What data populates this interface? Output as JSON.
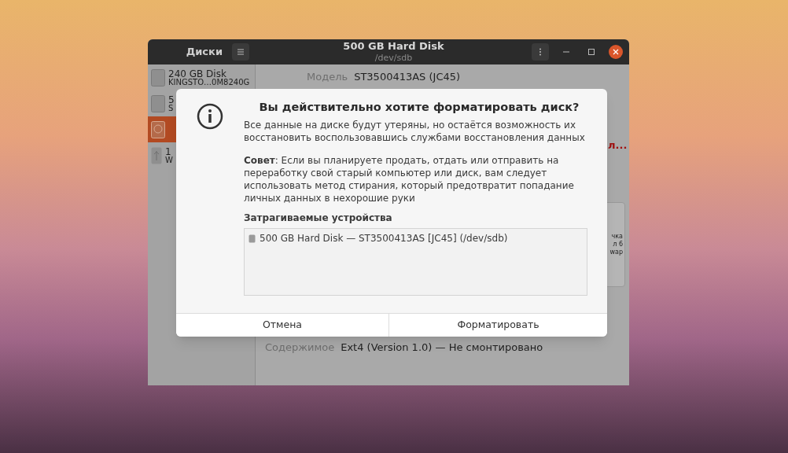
{
  "window": {
    "app_title": "Диски",
    "title": "500 GB Hard Disk",
    "subtitle": "/dev/sdb"
  },
  "sidebar": {
    "items": [
      {
        "kind": "ssd",
        "title": "240 GB Disk",
        "subtitle": "KINGSTO…0M8240G",
        "selected": false
      },
      {
        "kind": "ssd",
        "title": "5",
        "subtitle": "S",
        "selected": false
      },
      {
        "kind": "hdd",
        "selected": true
      },
      {
        "kind": "usb",
        "title": "1",
        "subtitle": "W",
        "selected": false
      }
    ]
  },
  "content": {
    "model_label": "Модель",
    "model_value": "ST3500413AS (JC45)",
    "warning": "л...",
    "partition_labels": [
      "чка",
      "л 6",
      "wap"
    ],
    "contents_label": "Содержимое",
    "contents_value": "Ext4 (Version 1.0) — Не смонтировано"
  },
  "dialog": {
    "title": "Вы действительно хотите форматировать диск?",
    "message": "Все данные на диске будут утеряны, но остаётся возможность их восстановить воспользовавшись службами восстановления данных",
    "advice": "**Совет**: Если вы планируете продать, отдать или отправить на переработку свой старый компьютер или диск, вам следует использовать метод стирания, который предотвратит попадание личных данных в нехорошие руки",
    "devices_heading": "Затрагиваемые устройства",
    "devices": [
      "500 GB Hard Disk — ST3500413AS [JC45] (/dev/sdb)"
    ],
    "buttons": [
      "Отмена",
      "Форматировать"
    ]
  }
}
